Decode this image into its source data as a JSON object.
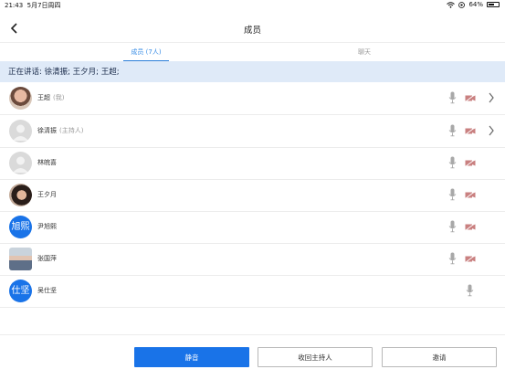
{
  "status_bar": {
    "time": "21:43",
    "date": "5月7日周四",
    "battery": "64%",
    "battery_level": 0.64
  },
  "nav": {
    "title": "成员"
  },
  "tabs": [
    {
      "label": "成员 (7人)",
      "active": true
    },
    {
      "label": "聊天",
      "active": false
    }
  ],
  "speaking_banner": "正在讲话: 徐清振; 王夕月; 王超;",
  "members": [
    {
      "name": "王超",
      "role": "(我)",
      "avatar": "photo",
      "avatar_text": "",
      "has_cam": true,
      "has_chevron": true
    },
    {
      "name": "徐清振",
      "role": "(主持人)",
      "avatar": "gray",
      "avatar_text": "",
      "has_cam": true,
      "has_chevron": true
    },
    {
      "name": "林皖喜",
      "role": "",
      "avatar": "gray",
      "avatar_text": "",
      "has_cam": true,
      "has_chevron": false
    },
    {
      "name": "王夕月",
      "role": "",
      "avatar": "photo",
      "avatar_text": "",
      "has_cam": true,
      "has_chevron": false
    },
    {
      "name": "尹旭熙",
      "role": "",
      "avatar": "blue",
      "avatar_text": "旭熙",
      "has_cam": true,
      "has_chevron": false
    },
    {
      "name": "张国萍",
      "role": "",
      "avatar": "photo",
      "avatar_text": "",
      "has_cam": true,
      "has_chevron": false
    },
    {
      "name": "吴仕坚",
      "role": "",
      "avatar": "blue",
      "avatar_text": "仕坚",
      "has_cam": false,
      "has_chevron": false
    }
  ],
  "buttons": {
    "mute": "静音",
    "revoke_host": "收回主持人",
    "invite": "邀请"
  },
  "colors": {
    "accent": "#1973e8",
    "banner_bg": "#dfeaf8",
    "muted_icon": "#a8a8a8",
    "cam_off": "#c98080"
  }
}
